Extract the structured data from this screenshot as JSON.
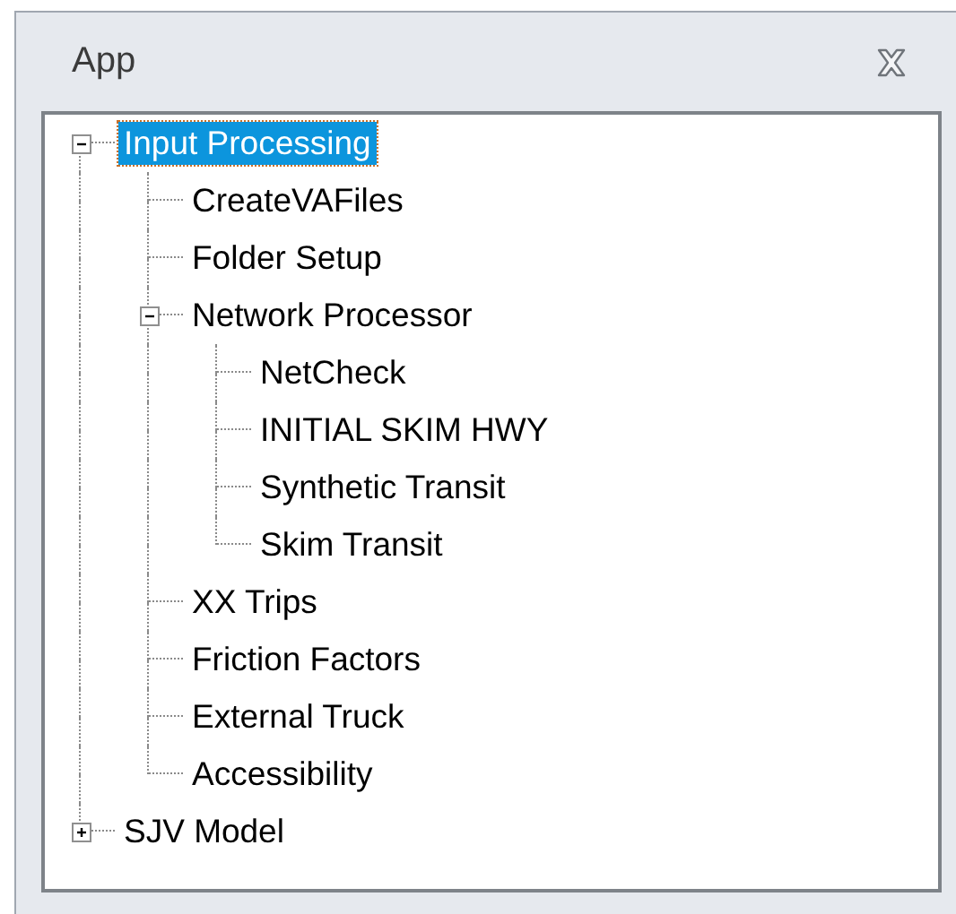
{
  "panel": {
    "title": "App"
  },
  "tree": [
    {
      "label": "Input Processing",
      "selected": true,
      "expanded": true,
      "children": [
        {
          "label": "CreateVAFiles",
          "selected": false
        },
        {
          "label": "Folder Setup",
          "selected": false
        },
        {
          "label": "Network Processor",
          "selected": false,
          "expanded": true,
          "children": [
            {
              "label": "NetCheck",
              "selected": false
            },
            {
              "label": "INITIAL SKIM HWY",
              "selected": false
            },
            {
              "label": "Synthetic Transit",
              "selected": false
            },
            {
              "label": "Skim Transit",
              "selected": false
            }
          ]
        },
        {
          "label": "XX Trips",
          "selected": false
        },
        {
          "label": "Friction Factors",
          "selected": false
        },
        {
          "label": "External Truck",
          "selected": false
        },
        {
          "label": "Accessibility",
          "selected": false
        }
      ]
    },
    {
      "label": "SJV Model",
      "selected": false,
      "expanded": false
    }
  ]
}
